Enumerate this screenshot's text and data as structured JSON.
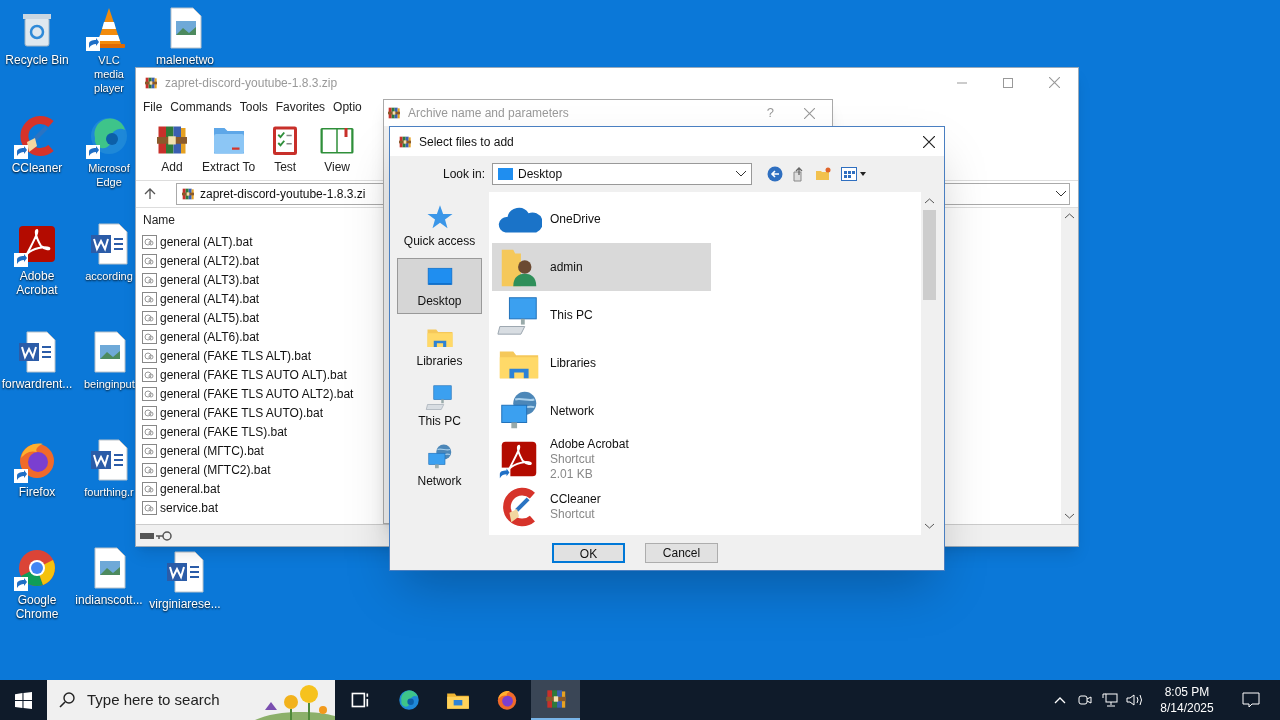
{
  "desktop": {
    "columns": [
      [
        {
          "label": "Recycle Bin",
          "kind": "recycle",
          "shortcut": false
        },
        {
          "label": "CCleaner",
          "kind": "ccleaner",
          "shortcut": true
        },
        {
          "label": "Adobe Acrobat",
          "kind": "acrobat",
          "shortcut": true
        },
        {
          "label": "forwardrent...",
          "kind": "word",
          "shortcut": false
        },
        {
          "label": "Firefox",
          "kind": "firefox",
          "shortcut": true
        },
        {
          "label": "Google Chrome",
          "kind": "chrome",
          "shortcut": true
        }
      ],
      [
        {
          "label": "VLC media player",
          "kind": "vlc",
          "shortcut": true
        },
        {
          "label": "Microsof Edge",
          "kind": "edge",
          "shortcut": true
        },
        {
          "label": "according",
          "kind": "word",
          "shortcut": false
        },
        {
          "label": "beinginput",
          "kind": "image",
          "shortcut": false
        },
        {
          "label": "fourthing.r",
          "kind": "word",
          "shortcut": false
        },
        {
          "label": "indianscott...",
          "kind": "image",
          "shortcut": false
        }
      ],
      [
        {
          "label": "malenetwo",
          "kind": "image",
          "shortcut": false
        },
        {
          "label": "virginiarese...",
          "kind": "word",
          "shortcut": false
        }
      ]
    ]
  },
  "winrar": {
    "title": "zapret-discord-youtube-1.8.3.zip",
    "menu": [
      "File",
      "Commands",
      "Tools",
      "Favorites",
      "Optio"
    ],
    "toolbar": [
      {
        "label": "Add",
        "kind": "add"
      },
      {
        "label": "Extract To",
        "kind": "extract"
      },
      {
        "label": "Test",
        "kind": "test"
      },
      {
        "label": "View",
        "kind": "view"
      }
    ],
    "path": "zapret-discord-youtube-1.8.3.zi",
    "column": "Name",
    "files": [
      "general (ALT).bat",
      "general (ALT2).bat",
      "general (ALT3).bat",
      "general (ALT4).bat",
      "general (ALT5).bat",
      "general (ALT6).bat",
      "general (FAKE TLS ALT).bat",
      "general (FAKE TLS AUTO ALT).bat",
      "general (FAKE TLS AUTO ALT2).bat",
      "general (FAKE TLS AUTO).bat",
      "general (FAKE TLS).bat",
      "general (МГТС).bat",
      "general (МГТС2).bat",
      "general.bat",
      "service.bat"
    ]
  },
  "archive_dialog": {
    "title": "Archive name and parameters",
    "help": "?"
  },
  "select_dialog": {
    "title": "Select files to add",
    "look_in_label": "Look in:",
    "look_in_value": "Desktop",
    "places": [
      {
        "label": "Quick access",
        "kind": "star",
        "selected": false
      },
      {
        "label": "Desktop",
        "kind": "desktop",
        "selected": true
      },
      {
        "label": "Libraries",
        "kind": "libraries",
        "selected": false
      },
      {
        "label": "This PC",
        "kind": "pc",
        "selected": false
      },
      {
        "label": "Network",
        "kind": "network",
        "selected": false
      }
    ],
    "items": [
      {
        "name": "OneDrive",
        "kind": "cloud",
        "selected": false
      },
      {
        "name": "admin",
        "kind": "user",
        "selected": true
      },
      {
        "name": "This PC",
        "kind": "pc",
        "selected": false
      },
      {
        "name": "Libraries",
        "kind": "libraries",
        "selected": false
      },
      {
        "name": "Network",
        "kind": "network",
        "selected": false
      },
      {
        "name": "Adobe Acrobat",
        "kind": "acrobat",
        "selected": false,
        "details": [
          "Shortcut",
          "2.01 KB"
        ]
      },
      {
        "name": "CCleaner",
        "kind": "ccleaner",
        "selected": false,
        "details": [
          "Shortcut"
        ]
      }
    ],
    "buttons": [
      {
        "label": "OK",
        "default": true
      },
      {
        "label": "Cancel",
        "default": false
      }
    ]
  },
  "taskbar": {
    "search_placeholder": "Type here to search",
    "apps": [
      {
        "kind": "taskview",
        "active": false
      },
      {
        "kind": "edge",
        "active": false
      },
      {
        "kind": "explorer",
        "active": false
      },
      {
        "kind": "firefox",
        "active": false
      },
      {
        "kind": "winrar",
        "active": true
      }
    ],
    "time": "8:05 PM",
    "date": "8/14/2025"
  }
}
